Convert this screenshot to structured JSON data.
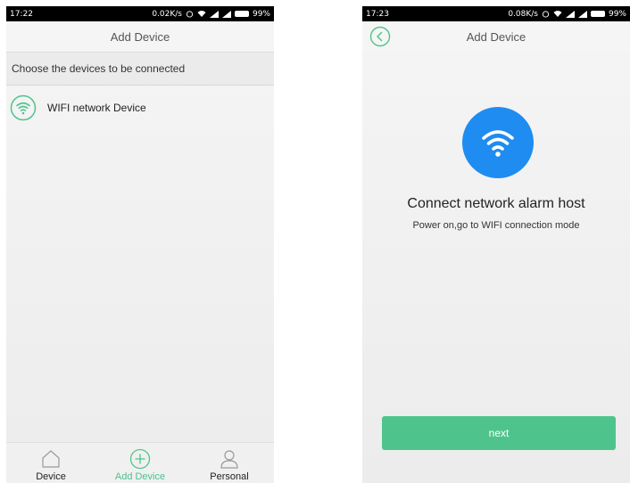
{
  "left_screen": {
    "status": {
      "time": "17:22",
      "speed": "0.02K/s",
      "battery": "99%"
    },
    "nav_title": "Add Device",
    "section_header": "Choose the devices to be connected",
    "devices": [
      {
        "label": "WIFI network Device",
        "icon": "wifi-icon"
      }
    ],
    "tabs": [
      {
        "label": "Device",
        "icon": "home-icon"
      },
      {
        "label": "Add Device",
        "icon": "plus-icon"
      },
      {
        "label": "Personal",
        "icon": "user-icon"
      }
    ]
  },
  "right_screen": {
    "status": {
      "time": "17:23",
      "speed": "0.08K/s",
      "battery": "99%"
    },
    "nav_title": "Add Device",
    "title": "Connect network alarm host",
    "subtitle": "Power on,go to WIFI connection mode",
    "next_label": "next"
  },
  "colors": {
    "accent": "#4ec48c",
    "hero": "#1e8cf0"
  }
}
